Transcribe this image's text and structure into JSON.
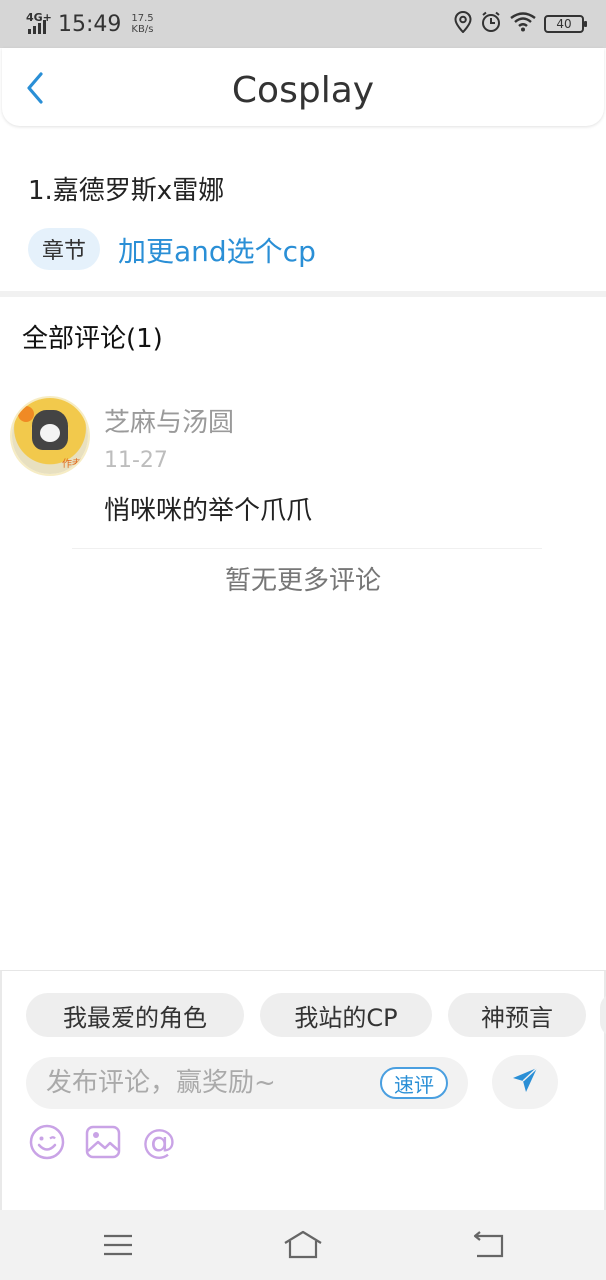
{
  "status_bar": {
    "network": "4G+",
    "time": "15:49",
    "speed_value": "17.5",
    "speed_unit": "KB/s",
    "battery": "40",
    "icons": [
      "location-icon",
      "alarm-icon",
      "wifi-icon",
      "battery-icon"
    ]
  },
  "header": {
    "title": "Cosplay",
    "back_icon": "chevron-left-icon"
  },
  "chapter": {
    "title": "1.嘉德罗斯x雷娜",
    "tag": "章节",
    "link": "加更and选个cp"
  },
  "comments": {
    "header": "全部评论(1)",
    "items": [
      {
        "user": "芝麻与汤圆",
        "date": "11-27",
        "text": "悄咪咪的举个爪爪",
        "avatar_badge": "作者"
      }
    ],
    "no_more": "暂无更多评论"
  },
  "composer": {
    "chips": [
      "我最爱的角色",
      "我站的CP",
      "神预言"
    ],
    "placeholder": "发布评论，赢奖励~",
    "quick_label": "速评",
    "send_icon": "send-icon",
    "tools": [
      "emoji-icon",
      "image-icon",
      "at-icon"
    ],
    "at_symbol": "@"
  },
  "nav": {
    "icons": [
      "menu-icon",
      "home-icon",
      "back-icon"
    ]
  },
  "colors": {
    "accent": "#2a8fd6",
    "tag_bg": "#e5f1fb",
    "tool_purple": "#c9a3e6",
    "status_bar_bg": "#d6d6d6"
  }
}
